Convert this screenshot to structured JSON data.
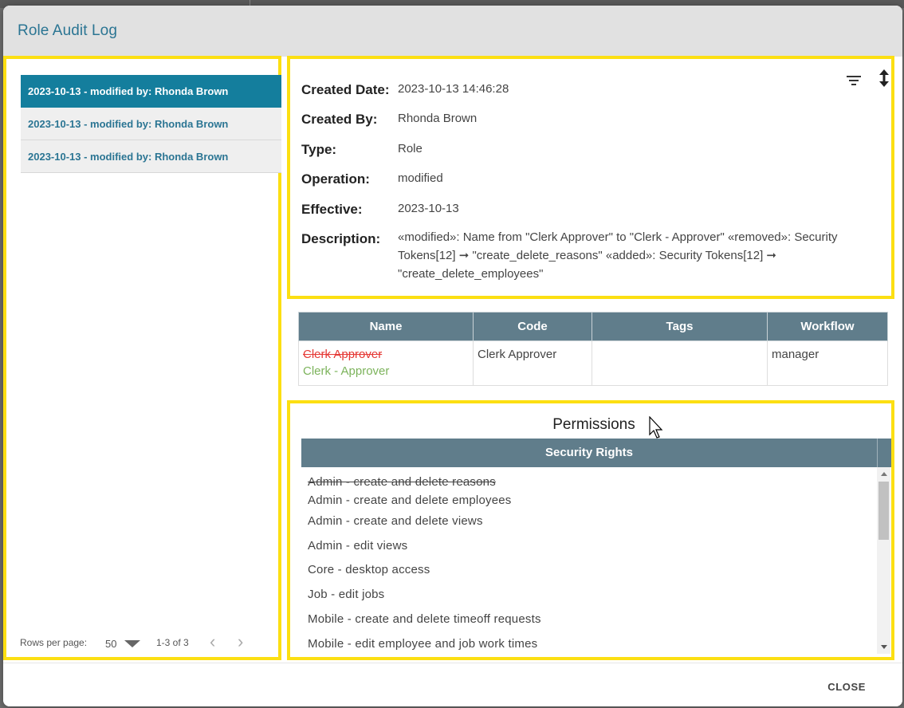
{
  "dialog": {
    "title": "Role Audit Log",
    "close_label": "CLOSE"
  },
  "audit_list": {
    "items": [
      {
        "label": "2023-10-13 - modified by: Rhonda Brown",
        "selected": true
      },
      {
        "label": "2023-10-13 - modified by: Rhonda Brown",
        "selected": false
      },
      {
        "label": "2023-10-13 - modified by: Rhonda Brown",
        "selected": false
      }
    ],
    "pagination": {
      "rows_per_page_label": "Rows per page:",
      "rows_per_page_value": "50",
      "range_label": "1-3 of 3"
    }
  },
  "details": {
    "created_date_label": "Created Date:",
    "created_date": "2023-10-13 14:46:28",
    "created_by_label": "Created By:",
    "created_by": "Rhonda Brown",
    "type_label": "Type:",
    "type": "Role",
    "operation_label": "Operation:",
    "operation": "modified",
    "effective_label": "Effective:",
    "effective": "2023-10-13",
    "description_label": "Description:",
    "description": "«modified»: Name from \"Clerk Approver\" to \"Clerk - Approver\" «removed»: Security Tokens[12] ➞ \"create_delete_reasons\" «added»: Security Tokens[12] ➞ \"create_delete_employees\""
  },
  "role_table": {
    "headers": [
      "Name",
      "Code",
      "Tags",
      "Workflow"
    ],
    "row": {
      "name_old": "Clerk Approver",
      "name_new": "Clerk - Approver",
      "code": "Clerk Approver",
      "tags": "",
      "workflow": "manager"
    }
  },
  "permissions": {
    "title": "Permissions",
    "column_header": "Security Rights",
    "items": [
      {
        "label": "Admin - create and delete reasons",
        "status": "removed"
      },
      {
        "label": "Admin - create and delete employees",
        "status": "added"
      },
      {
        "label": "Admin - create and delete views",
        "status": "unchanged"
      },
      {
        "label": "Admin - edit views",
        "status": "unchanged"
      },
      {
        "label": "Core - desktop access",
        "status": "unchanged"
      },
      {
        "label": "Job - edit jobs",
        "status": "unchanged"
      },
      {
        "label": "Mobile - create and delete timeoff requests",
        "status": "unchanged"
      },
      {
        "label": "Mobile - edit employee and job work times",
        "status": "unchanged"
      }
    ]
  },
  "colors": {
    "accent": "#2b7593",
    "selected_row": "#147e9d",
    "table_header": "#607d8b",
    "removed": "#e53935",
    "added": "#7cb35b",
    "highlight_border": "#fcdf12"
  },
  "icons": [
    "filter-icon",
    "sort-vertical-icon",
    "chevron-left-icon",
    "chevron-right-icon",
    "mouse-cursor-icon"
  ]
}
